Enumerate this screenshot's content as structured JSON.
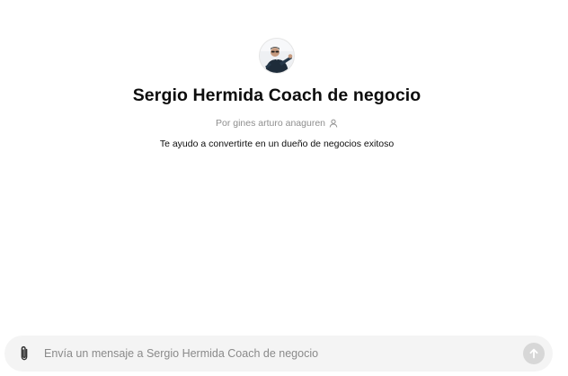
{
  "gpt": {
    "name": "Sergio Hermida Coach de negocio",
    "author": "Por gines arturo anaguren",
    "description": "Te ayudo a convertirte en un dueño de negocios exitoso",
    "avatar_icon": "coach-portrait-avatar",
    "author_icon": "person-icon"
  },
  "composer": {
    "placeholder": "Envía un mensaje a Sergio Hermida Coach de negocio",
    "value": "",
    "attach_icon": "paperclip-icon",
    "send_icon": "arrow-up-icon"
  }
}
